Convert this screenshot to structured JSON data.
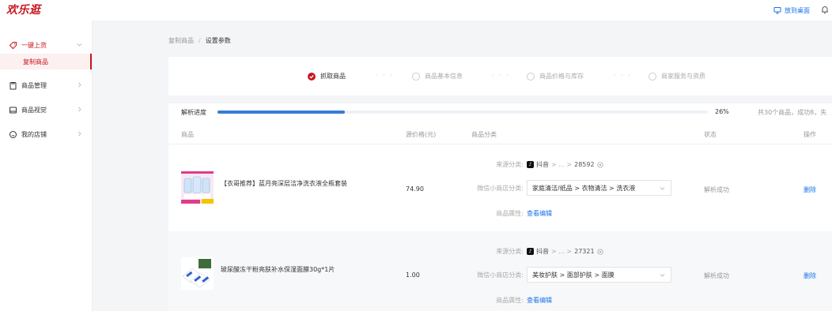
{
  "app": {
    "logo_text": "欢乐逛",
    "desktop_button": "放到桌面",
    "accent": "#c8161d",
    "link_color": "#1a73e8"
  },
  "sidebar": {
    "items": [
      {
        "label": "一键上货",
        "icon": "tag-icon"
      },
      {
        "label": "商品管理",
        "icon": "clipboard-icon"
      },
      {
        "label": "商品视觉",
        "icon": "image-icon"
      },
      {
        "label": "我的店铺",
        "icon": "smile-icon"
      }
    ],
    "sub_items": [
      {
        "label": "复制商品"
      }
    ]
  },
  "breadcrumb": {
    "parent": "复制商品",
    "separator": "/",
    "current": "设置参数"
  },
  "steps": [
    {
      "label": "抓取商品",
      "state": "done"
    },
    {
      "label": "商品基本信息",
      "state": "pending"
    },
    {
      "label": "商品价格与库存",
      "state": "pending"
    },
    {
      "label": "商家服务与资质",
      "state": "pending"
    }
  ],
  "steps_separator": "· · ·",
  "progress": {
    "label": "解析进度",
    "percent_text": "26%",
    "value": 26,
    "summary": "共30个商品，成功8，失"
  },
  "table": {
    "columns": {
      "product": "商品",
      "price": "源价格(元)",
      "category": "商品分类",
      "status": "状态",
      "action": "操作"
    },
    "row_labels": {
      "source": "来源分类:",
      "wechat": "微信小商店分类:",
      "attr": "商品属性:",
      "attr_link": "查看编辑",
      "platform": "抖音",
      "path": "> ... >"
    },
    "rows": [
      {
        "name": "【衣哥推荐】蓝月亮深层洁净洗衣液全瓶套装",
        "price": "74.90",
        "source_id": "28592",
        "category": "家庭清洁/纸品 > 衣物清洁 > 洗衣液",
        "status": "解析成功",
        "action": "删除"
      },
      {
        "name": "玻尿酸冻干粉亮肤补水保湿面膜30g*1片",
        "price": "1.00",
        "source_id": "27321",
        "category": "美妆护肤 > 面部护肤 > 面膜",
        "status": "解析成功",
        "action": "删除"
      }
    ]
  }
}
